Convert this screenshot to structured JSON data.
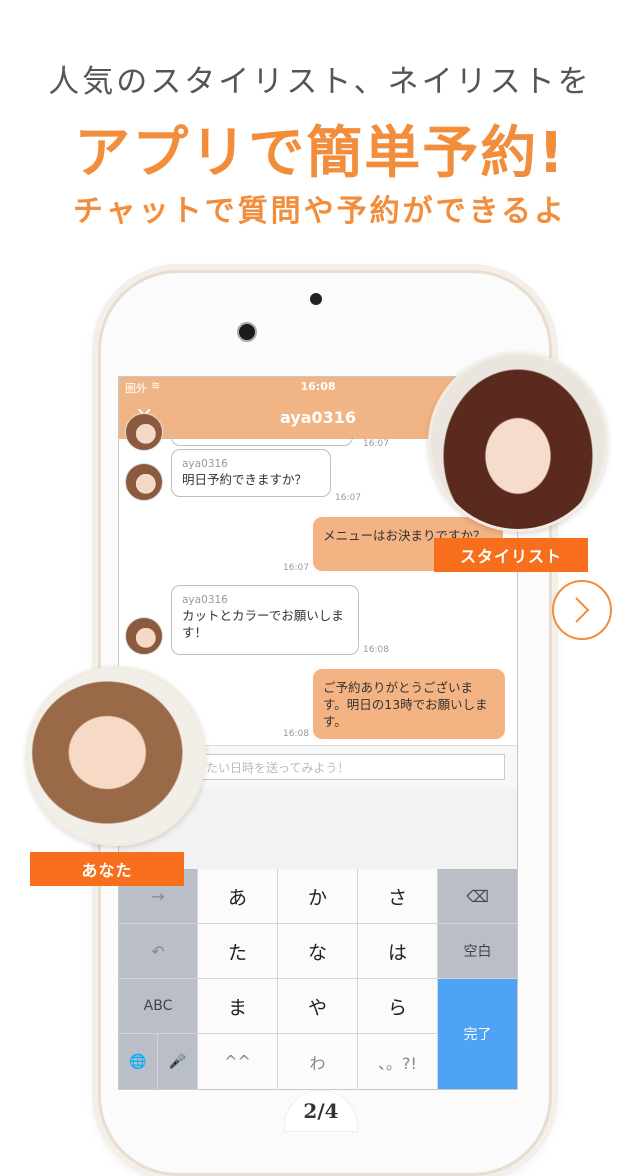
{
  "header": {
    "line1": "人気のスタイリスト、ネイリストを",
    "line2": "アプリで簡単予約!",
    "line3": "チャットで質問や予約ができるよ"
  },
  "status": {
    "carrier": "圏外",
    "time": "16:08"
  },
  "nav": {
    "close": "×",
    "title": "aya0316"
  },
  "messages": [
    {
      "sender": "aya0316",
      "text": "明日予約できますか？",
      "time": "16:07"
    },
    {
      "text": "メニューはお決まりですか？",
      "time": "16:07"
    },
    {
      "sender": "aya0316",
      "text": "カットとカラーでお願いします！",
      "time": "16:08"
    },
    {
      "text": "ご予約ありがとうございます。明日の13時でお願いします。",
      "time": "16:08"
    }
  ],
  "top_partial_time": "16:07",
  "input": {
    "placeholder": "たい日時を送ってみよう！"
  },
  "keyboard": {
    "row1": [
      "→",
      "あ",
      "か",
      "さ",
      "⌫"
    ],
    "row2": [
      "↶",
      "た",
      "な",
      "は",
      "空白"
    ],
    "row3": [
      "ABC",
      "ま",
      "や",
      "ら"
    ],
    "row4": [
      "🌐",
      "🎤",
      "^^",
      "わ",
      "、。?!"
    ],
    "done": "完了"
  },
  "labels": {
    "stylist": "スタイリスト",
    "you": "あなた"
  },
  "pager": {
    "current": "2/4"
  },
  "colors": {
    "accent": "#f28d3c",
    "tag": "#f76f1c",
    "bar": "#f1b585"
  }
}
